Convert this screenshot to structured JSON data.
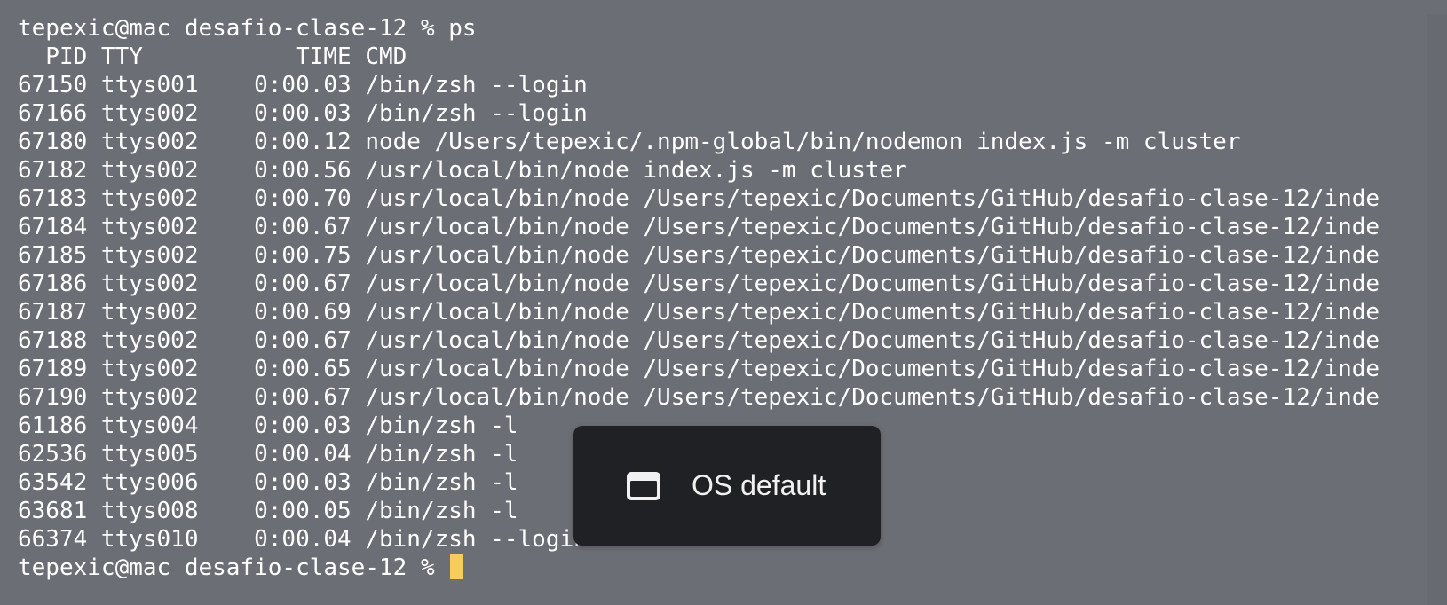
{
  "terminal": {
    "prompt_first": "tepexic@mac desafio-clase-12 % ps",
    "header": "  PID TTY           TIME CMD",
    "rows": [
      "67150 ttys001    0:00.03 /bin/zsh --login",
      "67166 ttys002    0:00.03 /bin/zsh --login",
      "67180 ttys002    0:00.12 node /Users/tepexic/.npm-global/bin/nodemon index.js -m cluster",
      "67182 ttys002    0:00.56 /usr/local/bin/node index.js -m cluster",
      "67183 ttys002    0:00.70 /usr/local/bin/node /Users/tepexic/Documents/GitHub/desafio-clase-12/inde",
      "67184 ttys002    0:00.67 /usr/local/bin/node /Users/tepexic/Documents/GitHub/desafio-clase-12/inde",
      "67185 ttys002    0:00.75 /usr/local/bin/node /Users/tepexic/Documents/GitHub/desafio-clase-12/inde",
      "67186 ttys002    0:00.67 /usr/local/bin/node /Users/tepexic/Documents/GitHub/desafio-clase-12/inde",
      "67187 ttys002    0:00.69 /usr/local/bin/node /Users/tepexic/Documents/GitHub/desafio-clase-12/inde",
      "67188 ttys002    0:00.67 /usr/local/bin/node /Users/tepexic/Documents/GitHub/desafio-clase-12/inde",
      "67189 ttys002    0:00.65 /usr/local/bin/node /Users/tepexic/Documents/GitHub/desafio-clase-12/inde",
      "67190 ttys002    0:00.67 /usr/local/bin/node /Users/tepexic/Documents/GitHub/desafio-clase-12/inde",
      "61186 ttys004    0:00.03 /bin/zsh -l",
      "62536 ttys005    0:00.04 /bin/zsh -l",
      "63542 ttys006    0:00.03 /bin/zsh -l",
      "63681 ttys008    0:00.05 /bin/zsh -l",
      "66374 ttys010    0:00.04 /bin/zsh --login"
    ],
    "prompt_last": "tepexic@mac desafio-clase-12 % "
  },
  "toast": {
    "label": "OS default",
    "icon": "window-icon"
  },
  "colors": {
    "background": "#6b6e74",
    "text": "#ffffff",
    "cursor": "#f7cc5f",
    "toast_bg": "#202124"
  }
}
